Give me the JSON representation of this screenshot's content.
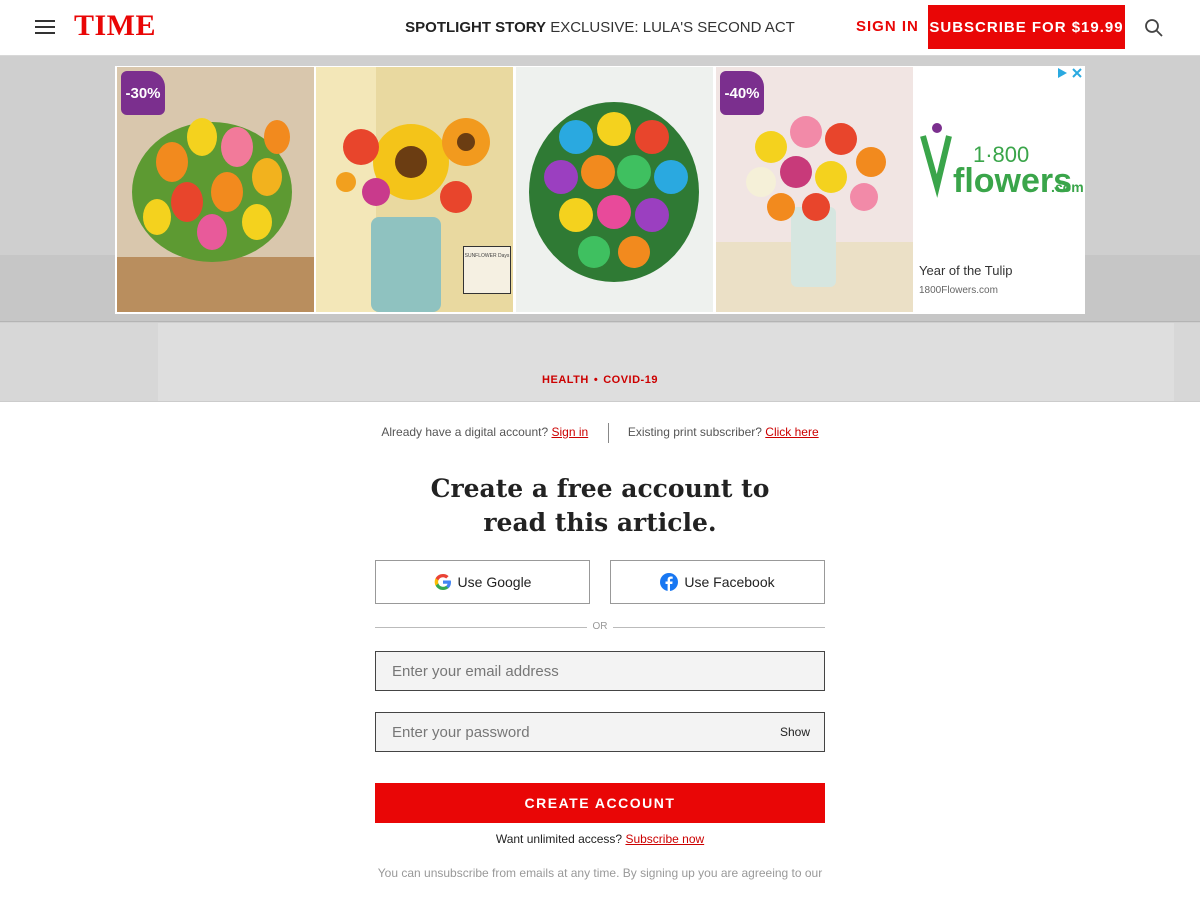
{
  "header": {
    "logo": "TIME",
    "spotlight_label": "SPOTLIGHT STORY",
    "spotlight_story": "EXCLUSIVE: LULA'S SECOND ACT",
    "signin_label": "SIGN IN",
    "subscribe_label": "SUBSCRIBE FOR $19.99",
    "icons": [
      "menu-icon",
      "search-icon"
    ]
  },
  "ad": {
    "badge_1": "-30%",
    "badge_2": "-40%",
    "thumb_text": "SUNFLOWER Days",
    "brand_number": "1·800",
    "brand_name": "flowers",
    "brand_suffix": ".com",
    "caption": "Year of the Tulip",
    "sub": "1800Flowers.com",
    "icons": [
      "ad-choices-icon",
      "close-icon"
    ]
  },
  "kicker": {
    "section": "HEALTH",
    "topic": "COVID-19"
  },
  "signup": {
    "digital_prompt": "Already have a digital account?",
    "digital_link": "Sign in",
    "print_prompt": "Existing print subscriber?",
    "print_link": "Click here",
    "title_line1": "Create a free account to",
    "title_line2": "read this article.",
    "google_label": "Use Google",
    "facebook_label": "Use Facebook",
    "or_label": "OR",
    "email_placeholder": "Enter your email address",
    "password_placeholder": "Enter your password",
    "show_label": "Show",
    "create_label": "CREATE ACCOUNT",
    "unlimited_prompt": "Want unlimited access?",
    "unlimited_link": "Subscribe now",
    "disclaimer": "You can unsubscribe from emails at any time. By signing up you are agreeing to our"
  },
  "colors": {
    "brand_red": "#e90606",
    "link_red": "#cc0000",
    "ad_purple": "#7b2f8e",
    "flowers_green": "#3aa54a",
    "facebook_blue": "#1877f2"
  }
}
